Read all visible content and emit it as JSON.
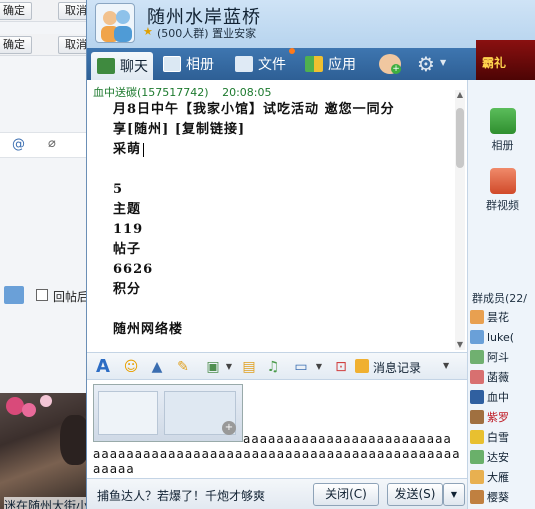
{
  "background": {
    "confirm_label_1": "确定",
    "cancel_label_1": "取消",
    "confirm_label_2": "确定",
    "cancel_label_2": "取消",
    "reply_label": "回帖后",
    "footer_text": "迷在随州大街小"
  },
  "window": {
    "title": "随州水岸蓝桥",
    "subtitle": "(500人群) 置业安家"
  },
  "tabs": [
    {
      "label": "聊天"
    },
    {
      "label": "相册"
    },
    {
      "label": "文件"
    },
    {
      "label": "应用"
    }
  ],
  "ad_text": "霸礼",
  "message": {
    "sender": "血中送碳(157517742)",
    "time": "20:08:05",
    "lines": [
      "月8日中午【我家小馆】试吃活动 邀您一同分",
      "享[随州] [复制链接]",
      "",
      "采萌",
      "",
      "5",
      "主题",
      "119",
      "帖子",
      "6626",
      "积分",
      "",
      "随州网络楼"
    ]
  },
  "right_panel": {
    "album_label": "相册",
    "video_label": "群视频",
    "members_title": "群成员(22/",
    "members": [
      "昙花",
      "luke(",
      "阿斗",
      "菡薇",
      "血中",
      "紫罗",
      "白雪",
      "达安",
      "大雁",
      "樱葵"
    ]
  },
  "toolbar": {
    "history_label": "消息记录"
  },
  "input": {
    "line1": "aaaaaaaaaaaaaaaaaaaaaaaaa",
    "line2": "aaaaaaaaaaaaaaaaaaaaaaaaaaaaaaaaaaaaaaaaaaaaaaaaa",
    "line3": "aaaaaaaaaaaaaaaaaaaaa"
  },
  "bottom": {
    "tip": "捕鱼达人？若爆了！千炮才够爽",
    "close_label": "关闭(C)",
    "send_label": "发送(S)"
  },
  "colors": {
    "tabbar": "#2e5f95",
    "titlebar": "#b7d4ee",
    "sender": "#1d7a2e"
  }
}
